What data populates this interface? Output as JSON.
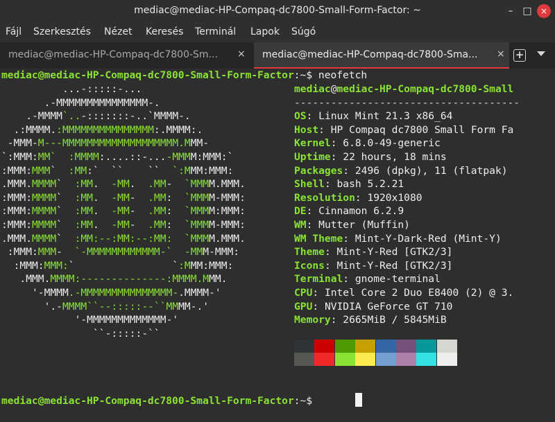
{
  "window": {
    "title": "mediac@mediac-HP-Compaq-dc7800-Small-Form-Factor: ~",
    "min": "–",
    "max": "□",
    "close": "×"
  },
  "menu": [
    "Fájl",
    "Szerkesztés",
    "Nézet",
    "Keresés",
    "Terminál",
    "Lapok",
    "Súgó"
  ],
  "tabs": [
    {
      "label": "mediac@mediac-HP-Compaq-dc7800-Sm...",
      "close": "×"
    },
    {
      "label": "mediac@mediac-HP-Compaq-dc7800-Sma...",
      "close": "×"
    }
  ],
  "tabbar": {
    "new_tab": "+"
  },
  "prompt": {
    "user_host": "mediac@mediac-HP-Compaq-dc7800-Small-Form-Factor",
    "path": ":~",
    "dollar": "$ ",
    "command": "neofetch"
  },
  "logo": [
    "          ...-:::::-...",
    "       .-MMMMMMMMMMMMMMM-.",
    "    .-MMMM`..-:::::::-..`MMMM-.",
    "  .:MMMM.:MMMMMMMMMMMMMMM:.MMMM:.",
    " -MMM-M---MMMMMMMMMMMMMMMMMMM.MMM-",
    "`:MMM:MM`  :MMMM:....::-...-MMMM:MMM:`",
    ":MMM:MMM`  :MM:`  ``    ``  `:MMM:MMM:",
    ".MMM.MMMM`  :MM.  -MM.  .MM-  `MMMM.MMM.",
    ":MMM:MMMM`  :MM.  -MM-  .MM:  `MMMM-MMM:",
    ":MMM:MMMM`  :MM.  -MM-  .MM:  `MMMM:MMM:",
    ":MMM:MMMM`  :MM.  -MM-  .MM:  `MMMM-MMM:",
    ".MMM.MMMM`  :MM:--:MM:--:MM:  `MMMM.MMM.",
    " :MMM:MMM-  `-MMMMMMMMMMMM-`  -MMM-MMM:",
    "  :MMM:MMM:`                `:MMM:MMM:",
    "   .MMM.MMMM:--------------:MMMM.MMM.",
    "     '-MMMM.-MMMMMMMMMMMMMMM-.MMMM-'",
    "       '.-MMMM``--:::::--``MMMM-.'",
    "            '-MMMMMMMMMMMMM-'",
    "               ``-:::::-``"
  ],
  "info": {
    "header": {
      "user": "mediac",
      "at": "@",
      "host": "mediac-HP-Compaq-dc7800-Small"
    },
    "separator": "-------------------------------------",
    "rows": [
      {
        "key": "OS",
        "value": "Linux Mint 21.3 x86_64"
      },
      {
        "key": "Host",
        "value": "HP Compaq dc7800 Small Form Fa"
      },
      {
        "key": "Kernel",
        "value": "6.8.0-49-generic"
      },
      {
        "key": "Uptime",
        "value": "22 hours, 18 mins"
      },
      {
        "key": "Packages",
        "value": "2496 (dpkg), 11 (flatpak)"
      },
      {
        "key": "Shell",
        "value": "bash 5.2.21"
      },
      {
        "key": "Resolution",
        "value": "1920x1080"
      },
      {
        "key": "DE",
        "value": "Cinnamon 6.2.9"
      },
      {
        "key": "WM",
        "value": "Mutter (Muffin)"
      },
      {
        "key": "WM Theme",
        "value": "Mint-Y-Dark-Red (Mint-Y)"
      },
      {
        "key": "Theme",
        "value": "Mint-Y-Red [GTK2/3]"
      },
      {
        "key": "Icons",
        "value": "Mint-Y-Red [GTK2/3]"
      },
      {
        "key": "Terminal",
        "value": "gnome-terminal"
      },
      {
        "key": "CPU",
        "value": "Intel Core 2 Duo E8400 (2) @ 3."
      },
      {
        "key": "GPU",
        "value": "NVIDIA GeForce GT 710"
      },
      {
        "key": "Memory",
        "value": "2665MiB / 5845MiB"
      }
    ],
    "colon": ": "
  },
  "palette": {
    "normal": [
      "#2e3436",
      "#cc0000",
      "#4e9a06",
      "#c4a000",
      "#3465a4",
      "#75507b",
      "#06989a",
      "#d3d7cf"
    ],
    "bright": [
      "#555753",
      "#ef2929",
      "#8ae234",
      "#fce94f",
      "#729fcf",
      "#ad7fa8",
      "#34e2e2",
      "#eeeeec"
    ]
  }
}
